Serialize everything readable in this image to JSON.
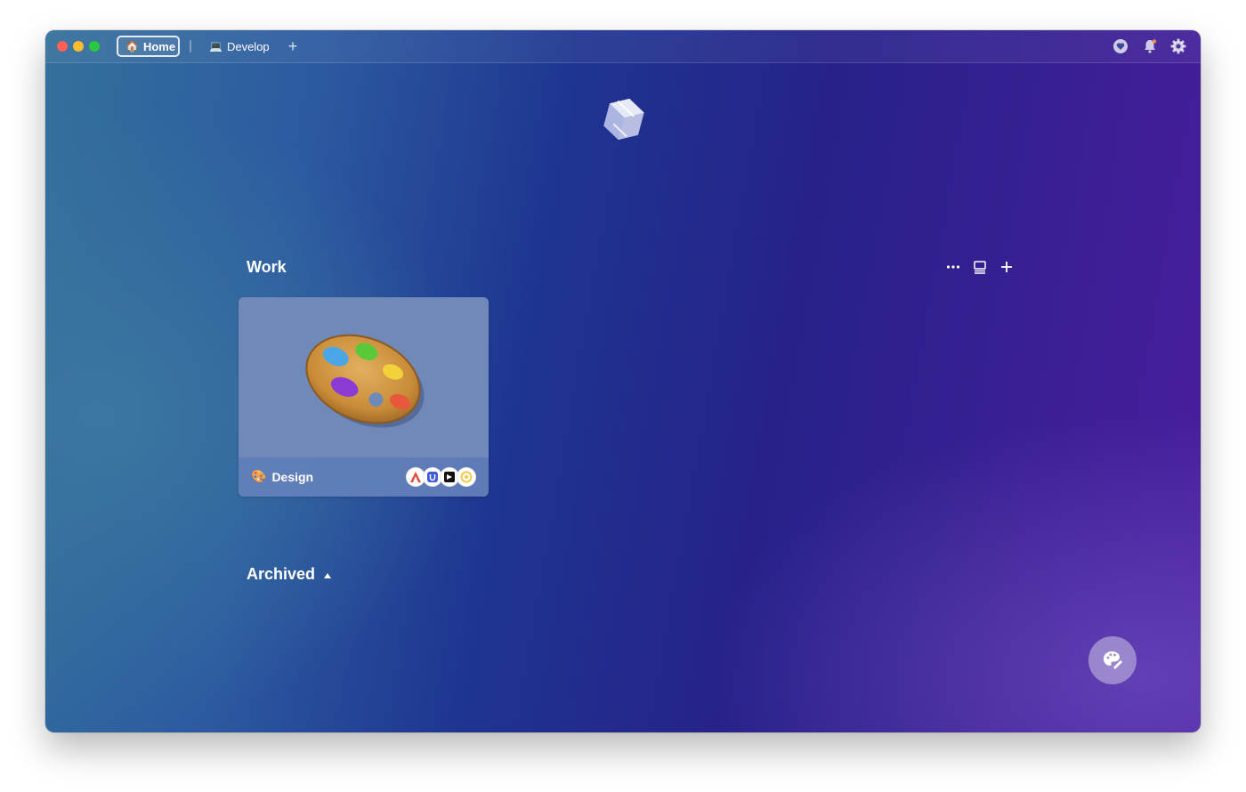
{
  "tabs": [
    {
      "label": "Home",
      "icon": "house-icon",
      "active": true
    },
    {
      "label": "Develop",
      "icon": "laptop-icon",
      "active": false
    }
  ],
  "toolbar": {
    "new_tab": "+",
    "icons": [
      "heart-icon",
      "bell-icon",
      "gear-icon"
    ]
  },
  "sections": {
    "work": {
      "title": "Work",
      "actions": [
        "more-icon",
        "layout-icon",
        "plus-icon"
      ],
      "cards": [
        {
          "title": "Design",
          "emoji": "🎨",
          "apps": [
            "affinity-icon",
            "uxpin-icon",
            "klokki-icon",
            "color-picker-icon"
          ]
        }
      ]
    },
    "archived": {
      "title": "Archived",
      "expanded": true
    }
  },
  "colors": {
    "bg_start": "#34709c",
    "bg_mid": "#1e3590",
    "bg_end": "#4a1ea0"
  }
}
